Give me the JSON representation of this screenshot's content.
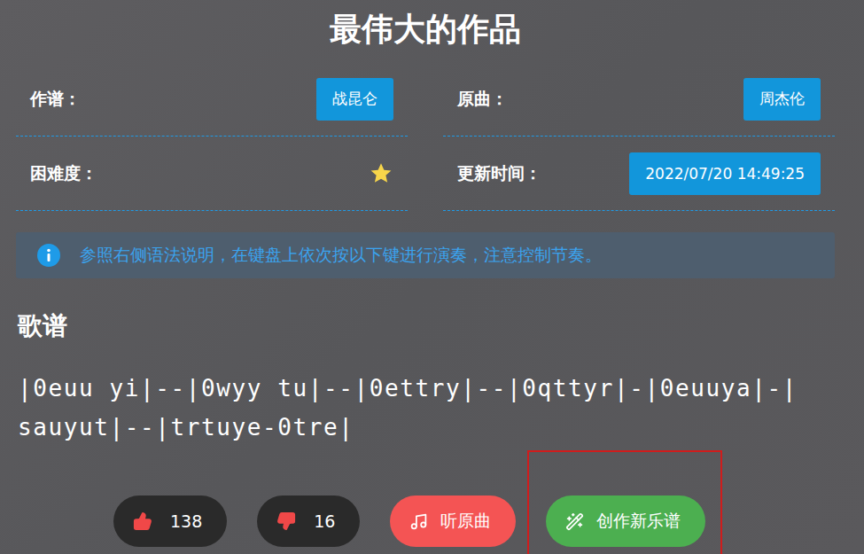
{
  "title": "最伟大的作品",
  "fields": [
    {
      "label": "作谱：",
      "kind": "tag",
      "value": "战昆仑"
    },
    {
      "label": "原曲：",
      "kind": "tag",
      "value": "周杰伦"
    },
    {
      "label": "困难度：",
      "kind": "stars",
      "stars": 1
    },
    {
      "label": "更新时间：",
      "kind": "tag",
      "value": "2022/07/20 14:49:25"
    }
  ],
  "notice": "参照右侧语法说明，在键盘上依次按以下键进行演奏，注意控制节奏。",
  "score": {
    "title": "歌谱",
    "lines": [
      "|0euu yi|--|0wyy tu|--|0ettry|--|0qttyr|-|0euuya|-|",
      "sauyut|--|trtuye-0tre|"
    ]
  },
  "actions": [
    {
      "label": "138",
      "kind": "like",
      "highlighted": false
    },
    {
      "label": "16",
      "kind": "dislike",
      "highlighted": false
    },
    {
      "label": "听原曲",
      "kind": "listen",
      "highlighted": false
    },
    {
      "label": "创作新乐谱",
      "kind": "create",
      "highlighted": true
    }
  ]
}
